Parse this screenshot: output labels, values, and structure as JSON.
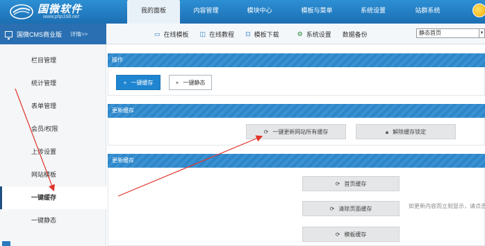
{
  "header": {
    "logo_title": "国微软件",
    "logo_url": "www.php168.net",
    "nav": [
      {
        "label": "我的面板",
        "active": true
      },
      {
        "label": "内容管理",
        "active": false
      },
      {
        "label": "模块中心",
        "active": false
      },
      {
        "label": "模板与菜单",
        "active": false
      },
      {
        "label": "系统设置",
        "active": false
      },
      {
        "label": "站群系统",
        "active": false
      }
    ]
  },
  "subbar": {
    "product": "国微CMS商业版",
    "detail": "详情>>",
    "links": [
      {
        "label": "在线模板",
        "icon": "monitor-icon"
      },
      {
        "label": "在线教程",
        "icon": "book-icon"
      },
      {
        "label": "模板下载",
        "icon": "download-icon"
      },
      {
        "label": "系统设置",
        "icon": "gear-icon"
      },
      {
        "label": "数据备份",
        "icon": ""
      }
    ],
    "select_value": "静态首页"
  },
  "sidebar": {
    "items": [
      {
        "label": "栏目管理",
        "active": false
      },
      {
        "label": "统计管理",
        "active": false
      },
      {
        "label": "表单管理",
        "active": false
      },
      {
        "label": "会员/权限",
        "active": false
      },
      {
        "label": "上传设置",
        "active": false
      },
      {
        "label": "网站模板",
        "active": false
      },
      {
        "label": "一键缓存",
        "active": true
      },
      {
        "label": "一键静态",
        "active": false
      }
    ]
  },
  "panels": {
    "ops": {
      "title": "操作",
      "btn_cache": "一键缓存",
      "btn_static": "一键静态"
    },
    "update": {
      "title": "更新缓存",
      "btn_update_all": "一键更新网站所有缓存",
      "btn_unlock": "解除缓存锁定"
    },
    "cache": {
      "title": "更新缓存",
      "btn_home": "首页缓存",
      "btn_clear": "清除页面缓存",
      "btn_template": "模板缓存",
      "note": "如更新内容而立刻显示，请点击"
    }
  },
  "colors": {
    "header_blue": "#1c6fb3",
    "product_blue": "#2a6fb1",
    "panel_blue": "#2e86c8",
    "button_blue": "#1f85d0",
    "arrow_red": "#e0342a"
  }
}
